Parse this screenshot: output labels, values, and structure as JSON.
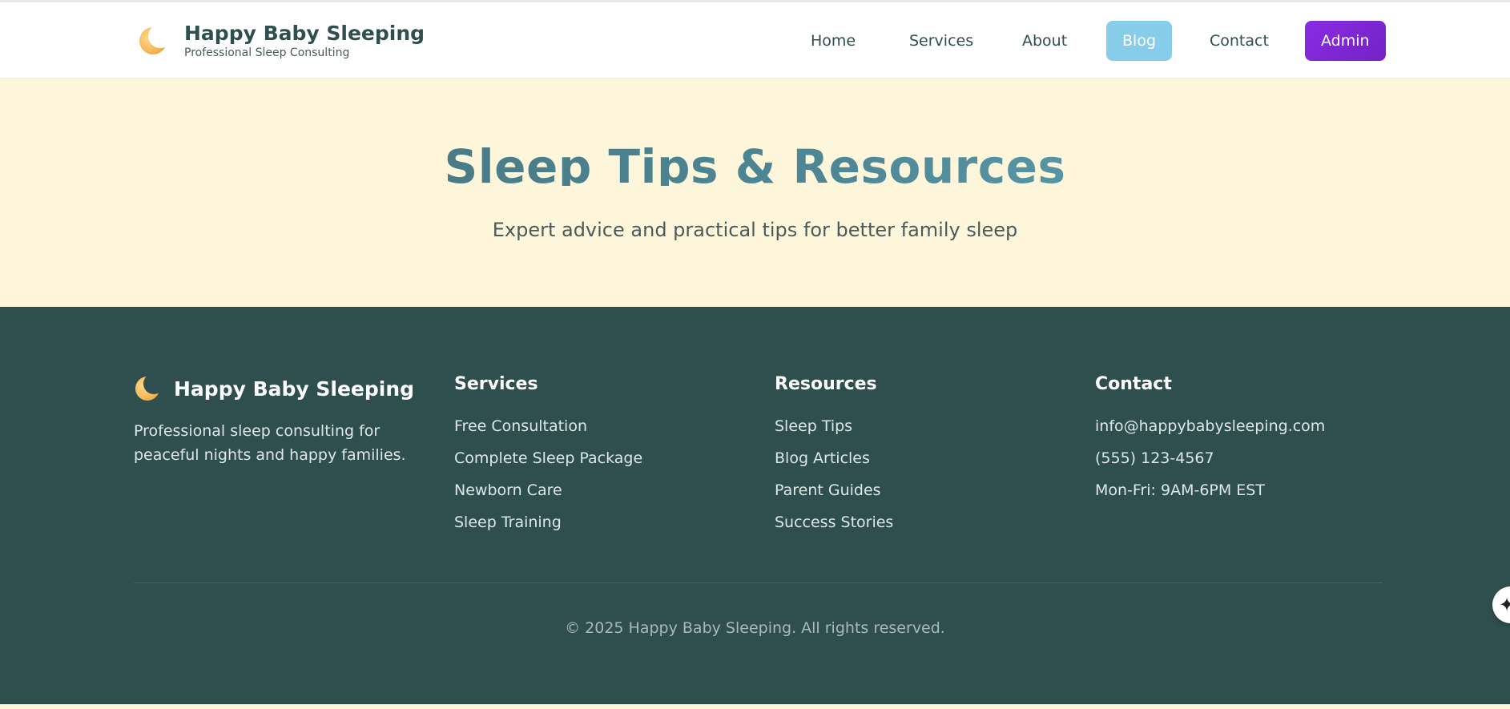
{
  "header": {
    "brand_title": "Happy Baby Sleeping",
    "brand_subtitle": "Professional Sleep Consulting",
    "logo_icon": "crescent-moon-icon",
    "nav": {
      "home": "Home",
      "services": "Services",
      "about": "About",
      "blog": "Blog",
      "contact": "Contact",
      "admin": "Admin"
    },
    "active_nav": "Blog",
    "colors": {
      "blog_active": "#87cdea",
      "admin": "#8a2be2"
    }
  },
  "hero": {
    "title": "Sleep Tips & Resources",
    "subtitle": "Expert advice and practical tips for better family sleep"
  },
  "footer": {
    "brand_title": "Happy Baby Sleeping",
    "description": "Professional sleep consulting for peaceful nights and happy families.",
    "columns": [
      {
        "heading": "Services",
        "items": [
          "Free Consultation",
          "Complete Sleep Package",
          "Newborn Care",
          "Sleep Training"
        ]
      },
      {
        "heading": "Resources",
        "items": [
          "Sleep Tips",
          "Blog Articles",
          "Parent Guides",
          "Success Stories"
        ]
      },
      {
        "heading": "Contact",
        "items": [
          "info@happybabysleeping.com",
          "(555) 123-4567",
          "Mon-Fri: 9AM-6PM EST"
        ]
      }
    ],
    "copyright": "© 2025 Happy Baby Sleeping. All rights reserved.",
    "colors": {
      "background": "#2f4f4f"
    }
  },
  "floating_button": {
    "icon": "sparkle-icon",
    "glyph": "✦"
  }
}
